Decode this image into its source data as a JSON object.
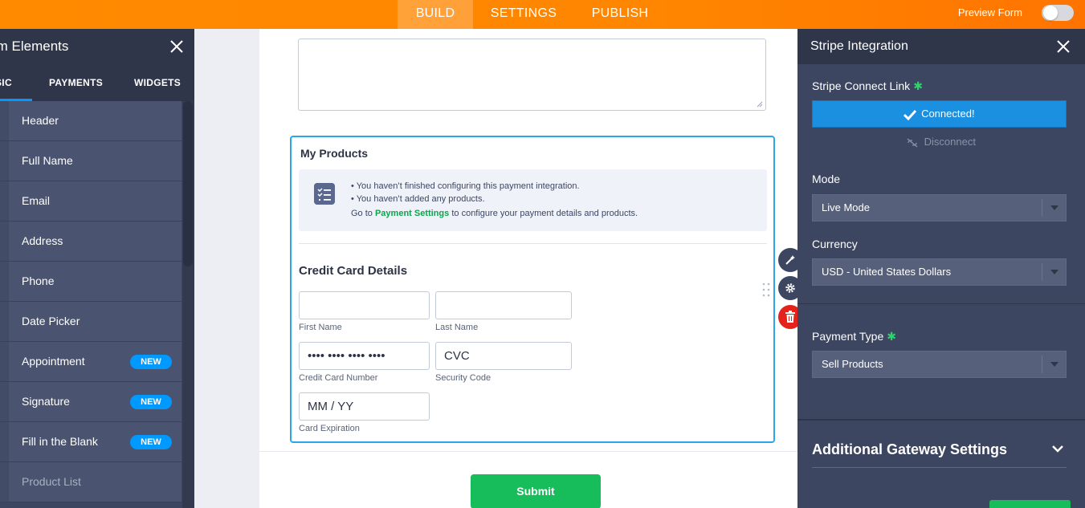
{
  "topbar": {
    "tabs": [
      "BUILD",
      "SETTINGS",
      "PUBLISH"
    ],
    "active_tab": "BUILD",
    "preview_label": "Preview Form",
    "preview_on": false,
    "accent": "#ff8a00"
  },
  "left_panel": {
    "title": "Form Elements",
    "title_visible": "rm Elements",
    "tabs": [
      "SIC",
      "PAYMENTS",
      "WIDGETS"
    ],
    "items": [
      {
        "label": "Header",
        "badge": ""
      },
      {
        "label": "Full Name",
        "badge": ""
      },
      {
        "label": "Email",
        "badge": ""
      },
      {
        "label": "Address",
        "badge": ""
      },
      {
        "label": "Phone",
        "badge": ""
      },
      {
        "label": "Date Picker",
        "badge": ""
      },
      {
        "label": "Appointment",
        "badge": "NEW"
      },
      {
        "label": "Signature",
        "badge": "NEW"
      },
      {
        "label": "Fill in the Blank",
        "badge": "NEW"
      },
      {
        "label": "Product List",
        "badge": ""
      }
    ]
  },
  "canvas": {
    "products_title": "My Products",
    "notice_lines": [
      "You haven’t finished configuring this payment integration.",
      "You haven’t added any products."
    ],
    "goto_prefix": "Go to",
    "goto_link": "Payment Settings",
    "goto_suffix": "to configure your payment details and products.",
    "cc_title": "Credit Card Details",
    "fields": {
      "first_name": {
        "value": "",
        "label": "First Name"
      },
      "last_name": {
        "value": "",
        "label": "Last Name"
      },
      "card_number": {
        "value": "•••• •••• •••• ••••",
        "label": "Credit Card Number"
      },
      "cvc": {
        "value": "CVC",
        "label": "Security Code"
      },
      "expiration": {
        "value": "MM / YY",
        "label": "Card Expiration"
      }
    },
    "submit_label": "Submit"
  },
  "right_panel": {
    "title": "Stripe Integration",
    "connect_label": "Stripe Connect Link",
    "connect_button": "Connected!",
    "disconnect": "Disconnect",
    "mode_label": "Mode",
    "mode_value": "Live Mode",
    "currency_label": "Currency",
    "currency_value": "USD - United States Dollars",
    "payment_type_label": "Payment Type",
    "payment_type_value": "Sell Products",
    "additional_label": "Additional Gateway Settings",
    "required_mark": "✱"
  }
}
